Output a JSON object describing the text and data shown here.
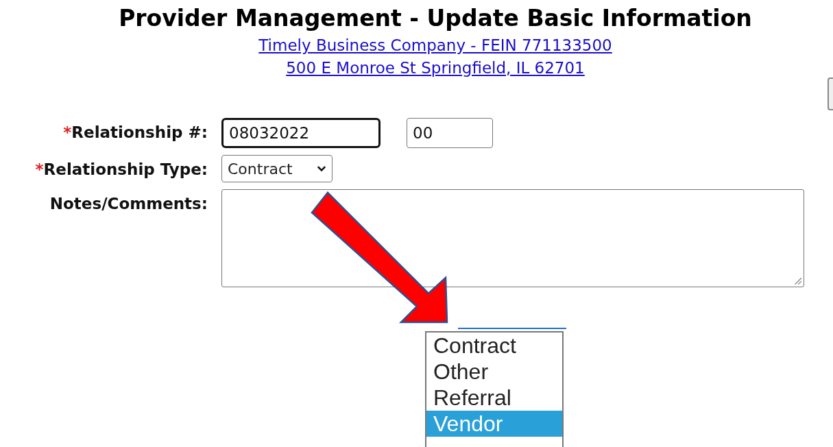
{
  "title": "Provider Management - Update Basic Information",
  "header_links": [
    "Timely Business Company - FEIN 771133500",
    "500 E Monroe St Springfield, IL 62701"
  ],
  "fields": [
    {
      "kind": "number",
      "label": "Relationship #:",
      "required_mark": "*",
      "value": "08032022",
      "suffix": "00",
      "focused": true
    },
    {
      "kind": "select",
      "label": "Relationship Type:",
      "required_mark": "*",
      "value": "Contract"
    },
    {
      "kind": "textarea",
      "label": "Notes/Comments:"
    }
  ],
  "dropdown": {
    "options": [
      {
        "label": "Contract",
        "selected": false
      },
      {
        "label": "Other",
        "selected": false
      },
      {
        "label": "Referral",
        "selected": false
      },
      {
        "label": "Vendor",
        "selected": true
      }
    ]
  }
}
